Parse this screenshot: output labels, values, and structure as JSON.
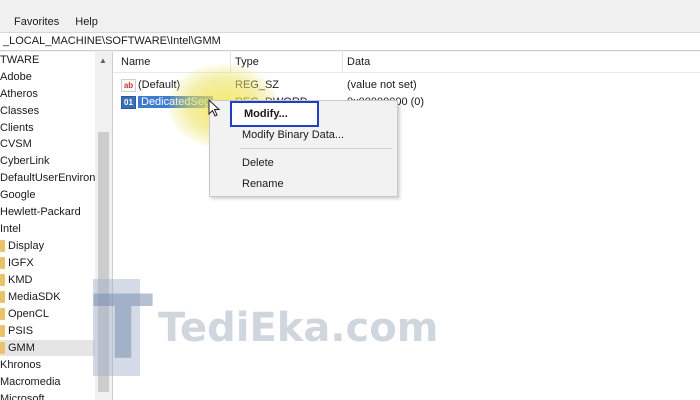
{
  "menu": [
    {
      "label": "Favorites"
    },
    {
      "label": "Help"
    }
  ],
  "address": {
    "path": "_LOCAL_MACHINE\\SOFTWARE\\Intel\\GMM"
  },
  "tree": {
    "items": [
      {
        "label": "TWARE"
      },
      {
        "label": "Adobe"
      },
      {
        "label": "Atheros"
      },
      {
        "label": "Classes"
      },
      {
        "label": "Clients"
      },
      {
        "label": "CVSM"
      },
      {
        "label": "CyberLink"
      },
      {
        "label": "DefaultUserEnvironn"
      },
      {
        "label": "Google"
      },
      {
        "label": "Hewlett-Packard"
      },
      {
        "label": "Intel"
      },
      {
        "label": "Display"
      },
      {
        "label": "IGFX"
      },
      {
        "label": "KMD"
      },
      {
        "label": "MediaSDK"
      },
      {
        "label": "OpenCL"
      },
      {
        "label": "PSIS"
      },
      {
        "label": "GMM"
      },
      {
        "label": "Khronos"
      },
      {
        "label": "Macromedia"
      },
      {
        "label": "Microsoft"
      }
    ]
  },
  "columns": {
    "name": "Name",
    "type": "Type",
    "data": "Data"
  },
  "values": [
    {
      "name": "(Default)",
      "type": "REG_SZ",
      "data": "(value not set)",
      "icon": "string-value-icon"
    },
    {
      "name": "DedicatedSeg",
      "type": "REG_DWORD",
      "data": "0x00000000 (0)",
      "icon": "binary-value-icon"
    }
  ],
  "context_menu": {
    "modify": "Modify...",
    "modify_binary": "Modify Binary Data...",
    "delete": "Delete",
    "rename": "Rename"
  },
  "watermark": {
    "letter": "T",
    "text": "TediEka.com"
  },
  "colors": {
    "selection": "#3d7bd0",
    "focus_border": "#1f3fc8",
    "highlight": "#f0e650"
  }
}
